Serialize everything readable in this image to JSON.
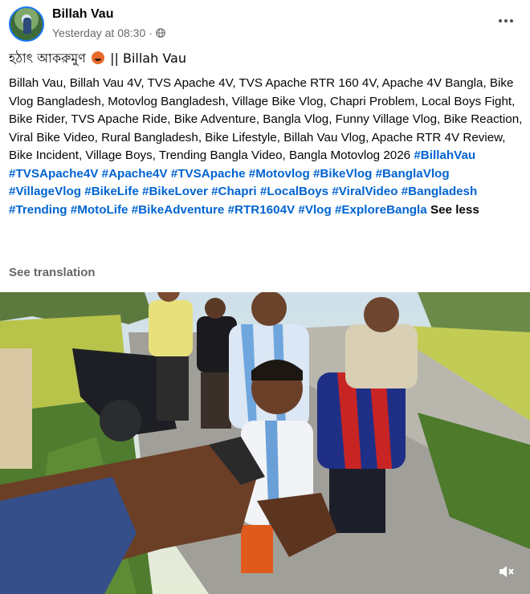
{
  "post": {
    "author": "Billah Vau",
    "timestamp": "Yesterday at 08:30",
    "separator": "·",
    "privacy_icon": "globe-icon",
    "more_icon": "more-horizontal-icon",
    "title_text": "হঠাৎ আকরুমুণ",
    "title_suffix": "|| Billah Vau",
    "title_emoji": "angry-face-emoji",
    "description": "Billah Vau, Billah Vau 4V, TVS Apache 4V, TVS Apache RTR 160 4V, Apache 4V Bangla, Bike Vlog Bangladesh, Motovlog Bangladesh, Village Bike Vlog, Chapri Problem, Local Boys Fight, Bike Rider, TVS Apache Ride, Bike Adventure, Bangla Vlog, Funny Village Vlog, Bike Reaction, Viral Bike Video, Rural Bangladesh, Bike Lifestyle, Billah Vau Vlog, Apache RTR 4V Review, Bike Incident, Village Boys, Trending Bangla Video, Bangla Motovlog 2026",
    "hashtags": "#BillahVau #TVSApache4V #Apache4V #TVSApache #Motovlog #BikeVlog #BanglaVlog #VillageVlog #BikeLife #BikeLover #Chapri #LocalBoys #ViralVideo #Bangladesh #Trending #MotoLife #BikeAdventure #RTR1604V #Vlog #ExploreBangla",
    "see_less": "See less",
    "see_translation": "See translation"
  },
  "video": {
    "mute_icon": "speaker-muted-icon",
    "colors": {
      "sky": "#c9dde6",
      "field": "#b7c648",
      "road": "#9a9a94",
      "grass": "#4e7a2c"
    }
  },
  "colors": {
    "link": "#0064d1",
    "secondary_text": "#65676b",
    "avatar_ring": "#1877f2"
  }
}
